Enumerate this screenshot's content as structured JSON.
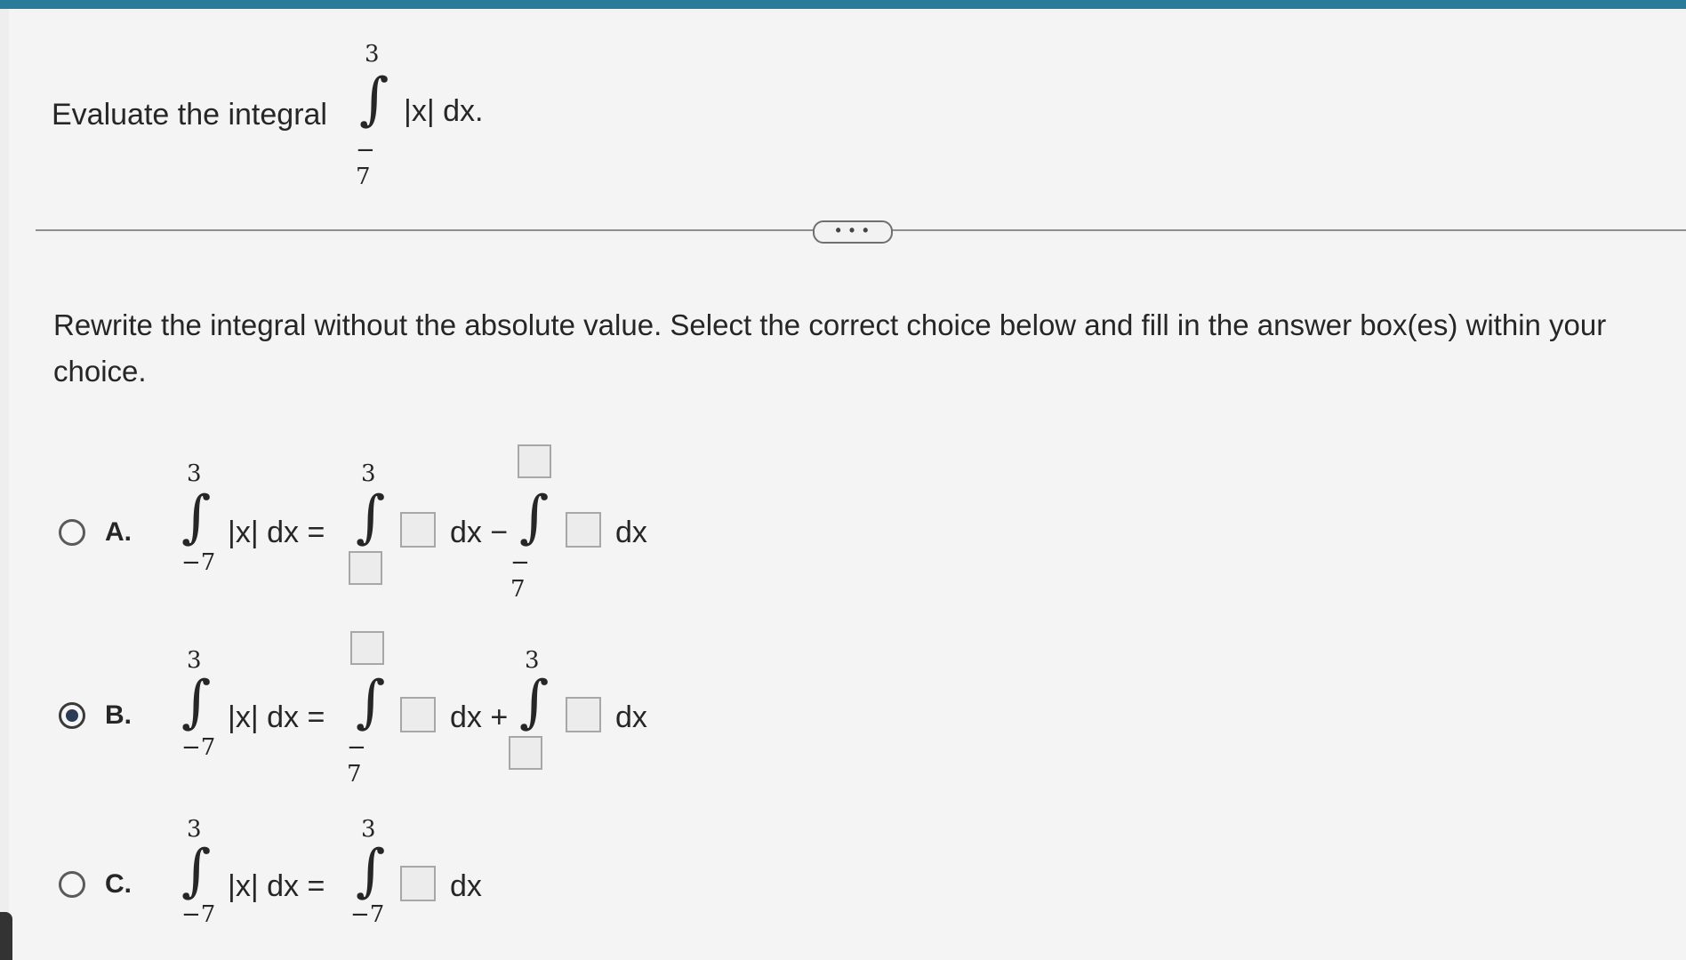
{
  "question": {
    "prefix": "Evaluate the integral",
    "upper": "3",
    "lower": "− 7",
    "integrand": "|x| dx."
  },
  "more_button": {
    "label": "• • •"
  },
  "instructions": "Rewrite the integral without the absolute value. Select the correct choice below and fill in the answer box(es) within your choice.",
  "choices": [
    {
      "letter": "A.",
      "selected": false,
      "lhs": {
        "upper": "3",
        "lower": "−7",
        "integrand": "|x| dx ="
      },
      "term1": {
        "upper": "3",
        "tail": "dx −"
      },
      "term2": {
        "lower": "− 7",
        "tail": "dx"
      }
    },
    {
      "letter": "B.",
      "selected": true,
      "lhs": {
        "upper": "3",
        "lower": "−7",
        "integrand": "|x| dx ="
      },
      "term1": {
        "lower": "− 7",
        "tail": "dx +"
      },
      "term2": {
        "upper": "3",
        "tail": "dx"
      }
    },
    {
      "letter": "C.",
      "selected": false,
      "lhs": {
        "upper": "3",
        "lower": "−7",
        "integrand": "|x| dx ="
      },
      "term1": {
        "upper": "3",
        "lower": "−7",
        "tail": "dx"
      }
    }
  ]
}
